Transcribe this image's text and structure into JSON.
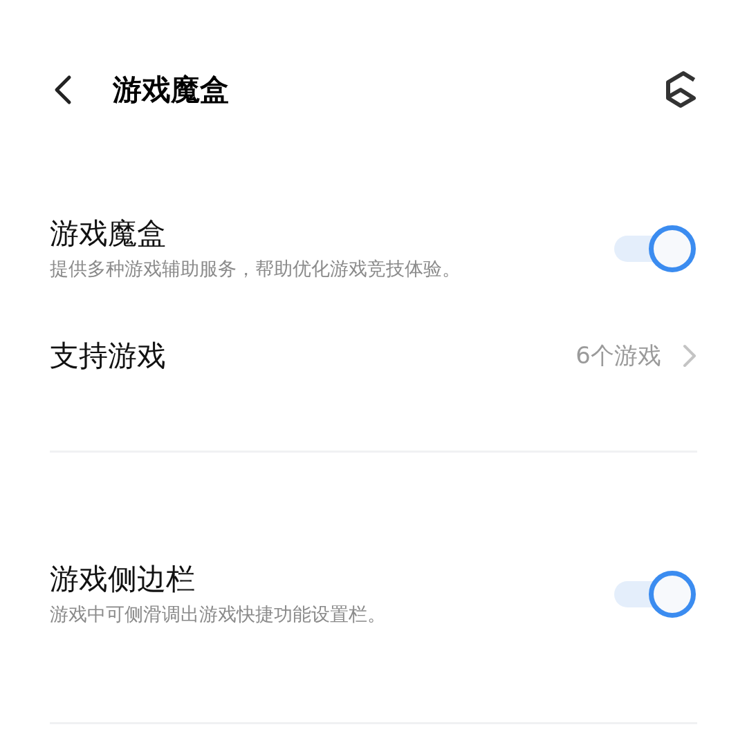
{
  "header": {
    "title": "游戏魔盒"
  },
  "sections": [
    {
      "items": [
        {
          "kind": "toggle",
          "title": "游戏魔盒",
          "description": "提供多种游戏辅助服务，帮助优化游戏竞技体验。",
          "on": true
        },
        {
          "kind": "link",
          "title": "支持游戏",
          "value": "6个游戏"
        }
      ]
    },
    {
      "items": [
        {
          "kind": "toggle",
          "title": "游戏侧边栏",
          "description": "游戏中可侧滑调出游戏快捷功能设置栏。",
          "on": true
        }
      ]
    }
  ]
}
